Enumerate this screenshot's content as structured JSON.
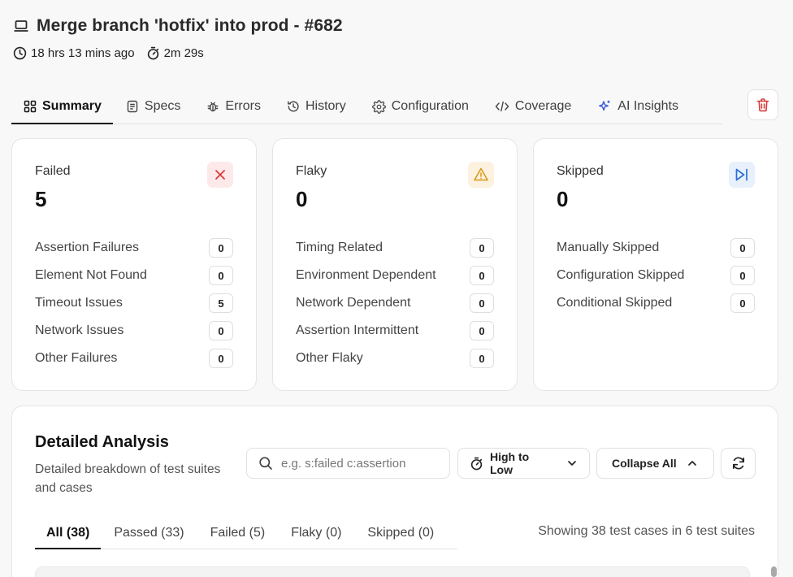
{
  "header": {
    "title": "Merge branch 'hotfix' into prod - #682",
    "time_ago": "18 hrs 13 mins ago",
    "duration": "2m 29s"
  },
  "tabs": [
    {
      "label": "Summary",
      "icon": "grid-icon",
      "active": true
    },
    {
      "label": "Specs",
      "icon": "document-icon"
    },
    {
      "label": "Errors",
      "icon": "bug-icon"
    },
    {
      "label": "History",
      "icon": "history-icon"
    },
    {
      "label": "Configuration",
      "icon": "gear-icon"
    },
    {
      "label": "Coverage",
      "icon": "code-icon"
    },
    {
      "label": "AI Insights",
      "icon": "sparkle-icon"
    }
  ],
  "cards": {
    "failed": {
      "label": "Failed",
      "count": "5",
      "icon": "close-icon",
      "accent": "#d93a3a",
      "icon_bg": "#fde9e9",
      "rows": [
        {
          "label": "Assertion Failures",
          "count": "0"
        },
        {
          "label": "Element Not Found",
          "count": "0"
        },
        {
          "label": "Timeout Issues",
          "count": "5"
        },
        {
          "label": "Network Issues",
          "count": "0"
        },
        {
          "label": "Other Failures",
          "count": "0"
        }
      ]
    },
    "flaky": {
      "label": "Flaky",
      "count": "0",
      "icon": "warning-icon",
      "accent": "#d89a1a",
      "icon_bg": "#fdf1e0",
      "rows": [
        {
          "label": "Timing Related",
          "count": "0"
        },
        {
          "label": "Environment Dependent",
          "count": "0"
        },
        {
          "label": "Network Dependent",
          "count": "0"
        },
        {
          "label": "Assertion Intermittent",
          "count": "0"
        },
        {
          "label": "Other Flaky",
          "count": "0"
        }
      ]
    },
    "skipped": {
      "label": "Skipped",
      "count": "0",
      "icon": "skip-forward-icon",
      "accent": "#2b6fd6",
      "icon_bg": "#e8f0fc",
      "rows": [
        {
          "label": "Manually Skipped",
          "count": "0"
        },
        {
          "label": "Configuration Skipped",
          "count": "0"
        },
        {
          "label": "Conditional Skipped",
          "count": "0"
        }
      ]
    }
  },
  "analysis": {
    "title": "Detailed Analysis",
    "subtitle": "Detailed breakdown of test suites and cases",
    "search_placeholder": "e.g. s:failed c:assertion",
    "sort_label": "High to Low",
    "collapse_label": "Collapse All",
    "subtabs": [
      {
        "label": "All (38)",
        "active": true
      },
      {
        "label": "Passed (33)"
      },
      {
        "label": "Failed (5)"
      },
      {
        "label": "Flaky (0)"
      },
      {
        "label": "Skipped (0)"
      }
    ],
    "showing": "Showing 38 test cases in 6 test suites"
  }
}
